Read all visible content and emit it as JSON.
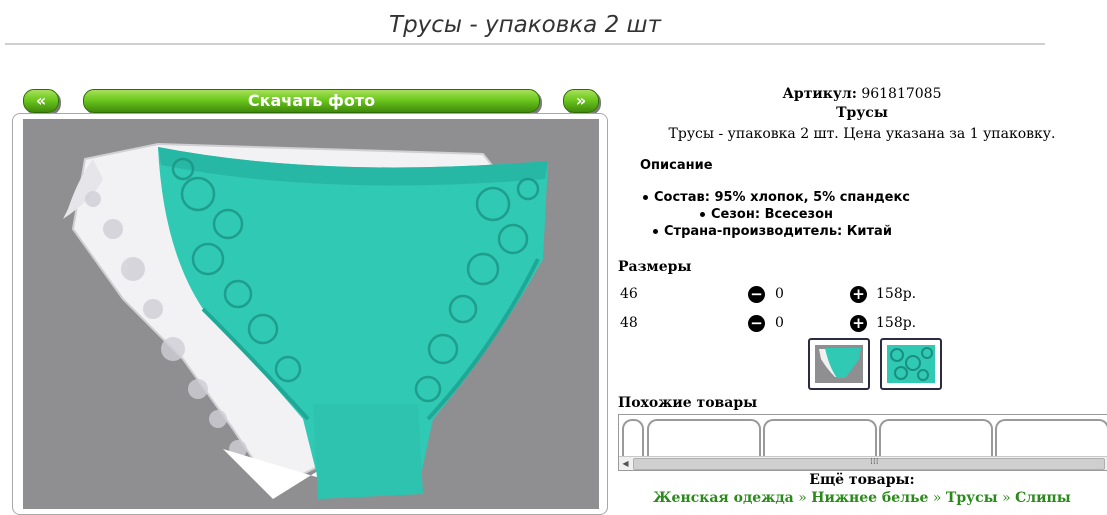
{
  "title": "Трусы - упаковка 2 шт",
  "nav": {
    "prev": "«",
    "download": "Скачать фото",
    "next": "»"
  },
  "product": {
    "article_label": "Артикул:",
    "article": "961817085",
    "name": "Трусы",
    "description": "Трусы - упаковка 2 шт. Цена указана за 1 упаковку.",
    "description_heading": "Описание",
    "specs": [
      {
        "label": "Состав:",
        "value": "95% хлопок, 5% спандекс"
      },
      {
        "label": "Сезон:",
        "value": "Всесезон"
      },
      {
        "label": "Страна-производитель:",
        "value": "Китай"
      }
    ]
  },
  "sizes": {
    "heading": "Размеры",
    "rows": [
      {
        "size": "46",
        "qty": "0",
        "price": "158р."
      },
      {
        "size": "48",
        "qty": "0",
        "price": "158р."
      }
    ]
  },
  "similar_heading": "Похожие товары",
  "more_heading": "Ещё товары:",
  "breadcrumbs": [
    "Женская одежда",
    "Нижнее белье",
    "Трусы",
    "Слипы"
  ],
  "breadcrumb_sep": "»",
  "colors": {
    "button_green": "#6cc81e",
    "turquoise": "#2fc9b4",
    "photo_bg": "#8f8e90",
    "link_green": "#2a8a1a"
  }
}
